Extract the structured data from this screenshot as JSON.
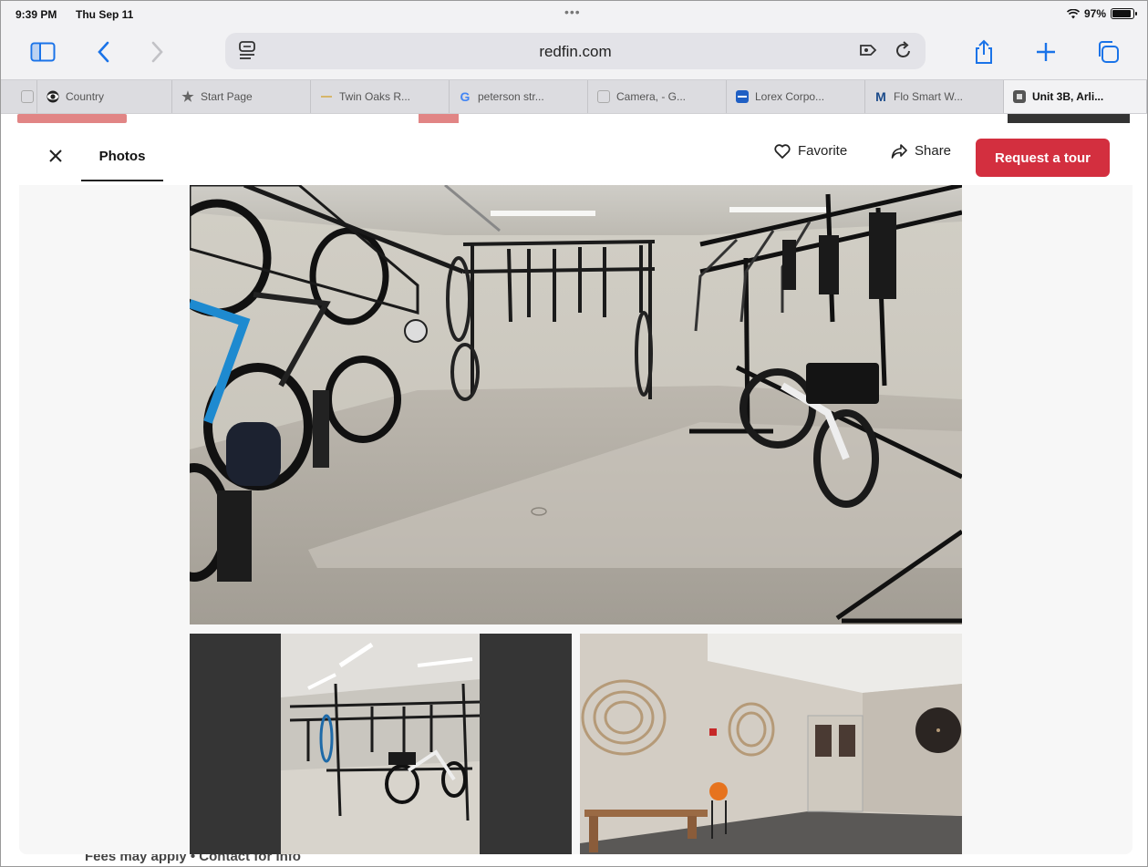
{
  "status_bar": {
    "time": "9:39 PM",
    "date": "Thu Sep 11",
    "battery": "97%",
    "battery_level": 0.97,
    "icons": [
      "wifi-icon",
      "battery-icon"
    ]
  },
  "toolbar": {
    "url": "redfin.com",
    "accent_color": "#1a73e8",
    "icons": [
      "sidebar-icon",
      "back-icon",
      "forward-icon",
      "reader-icon",
      "extension-icon",
      "reload-icon",
      "share-icon",
      "new-tab-icon",
      "tabs-overview-icon"
    ]
  },
  "tabs": [
    {
      "label": "Country",
      "icon": "cbs-eye-icon",
      "active": false
    },
    {
      "label": "Start Page",
      "icon": "star-icon",
      "active": false
    },
    {
      "label": "Twin Oaks R...",
      "icon": "twin-oaks-icon",
      "active": false
    },
    {
      "label": "peterson str...",
      "icon": "google-icon",
      "active": false
    },
    {
      "label": "Camera, - G...",
      "icon": "camera-icon",
      "active": false
    },
    {
      "label": "Lorex Corpo...",
      "icon": "lorex-icon",
      "active": false
    },
    {
      "label": "Flo Smart W...",
      "icon": "moen-icon",
      "active": false
    },
    {
      "label": "Unit 3B, Arli...",
      "icon": "redfin-icon",
      "active": true
    }
  ],
  "modal": {
    "photos_tab": "Photos",
    "favorite_label": "Favorite",
    "share_label": "Share",
    "tour_button": "Request a tour",
    "tour_button_color": "#d32f3f",
    "photos": [
      {
        "name": "bike-storage-room"
      },
      {
        "name": "bike-racks-room"
      },
      {
        "name": "lobby-room"
      }
    ]
  },
  "page_behind": {
    "fees_text": "Fees may apply • Contact for info"
  }
}
